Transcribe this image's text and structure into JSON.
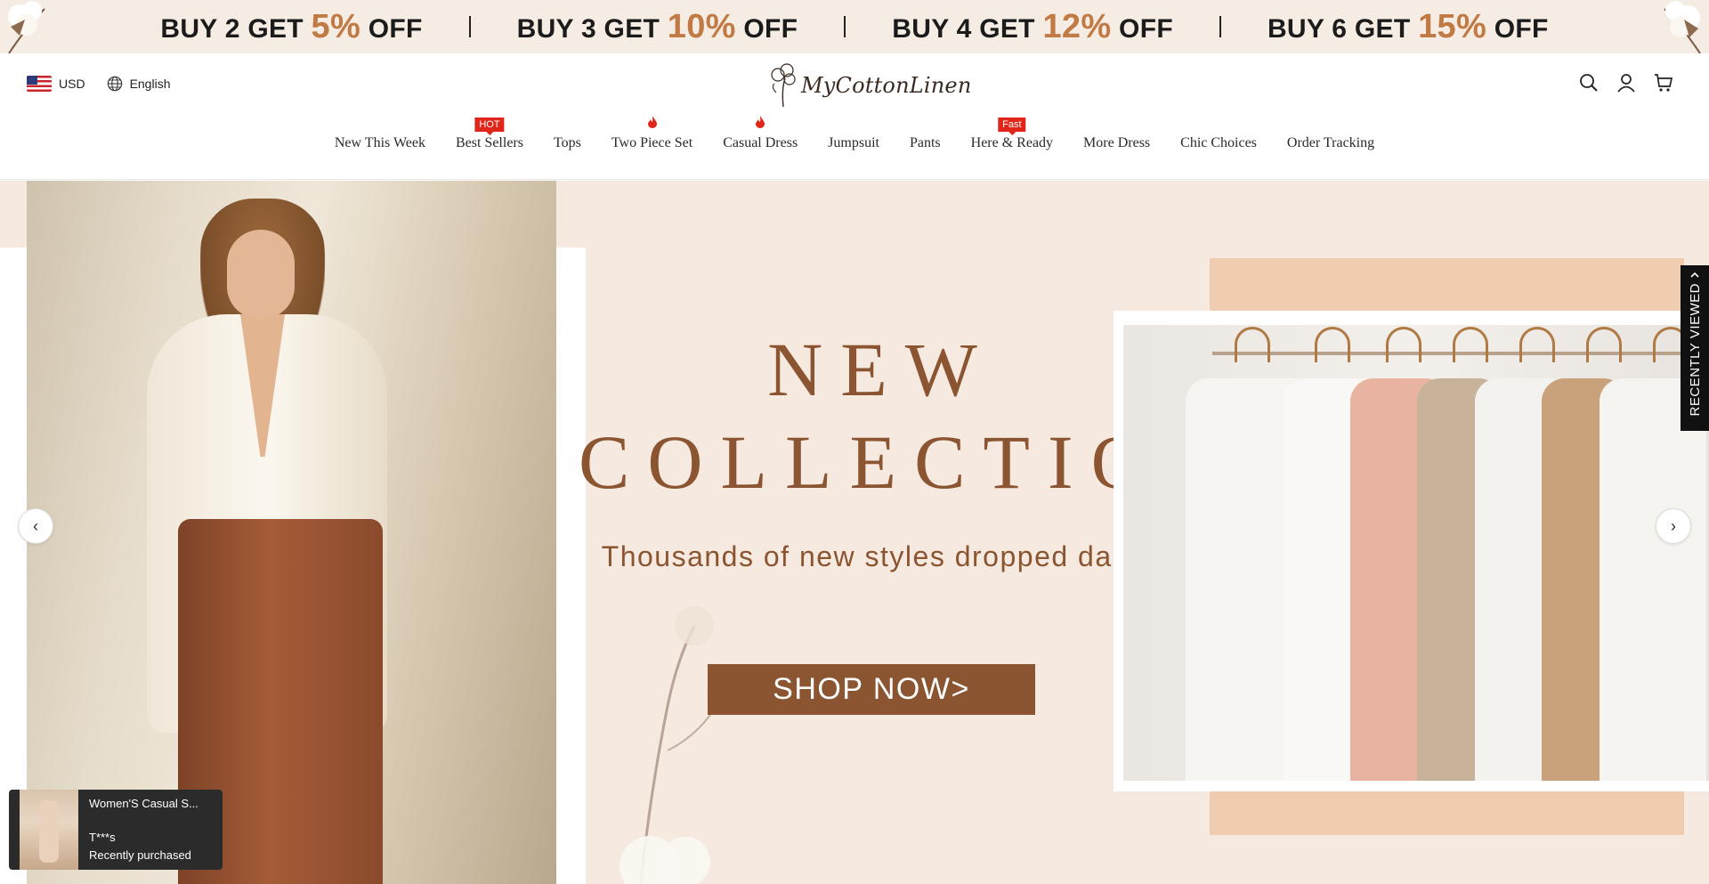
{
  "promo": {
    "items": [
      {
        "prefix": "BUY 2 GET ",
        "pct": "5%",
        "suffix": " OFF"
      },
      {
        "prefix": "BUY 3 GET ",
        "pct": "10%",
        "suffix": " OFF"
      },
      {
        "prefix": "BUY 4 GET ",
        "pct": "12%",
        "suffix": " OFF"
      },
      {
        "prefix": "BUY 6 GET ",
        "pct": "15%",
        "suffix": " OFF"
      }
    ],
    "accent_color": "#c27a45"
  },
  "header": {
    "currency": "USD",
    "language": "English",
    "logo_text": "MyCottonLinen",
    "icons": [
      "search-icon",
      "account-icon",
      "cart-icon"
    ]
  },
  "nav": {
    "items": [
      {
        "label": "New This Week"
      },
      {
        "label": "Best Sellers",
        "badge": "HOT"
      },
      {
        "label": "Tops"
      },
      {
        "label": "Two Piece Set",
        "fire": true
      },
      {
        "label": "Casual Dress",
        "fire": true
      },
      {
        "label": "Jumpsuit"
      },
      {
        "label": "Pants"
      },
      {
        "label": "Here & Ready",
        "badge": "Fast"
      },
      {
        "label": "More Dress"
      },
      {
        "label": "Chic Choices"
      },
      {
        "label": "Order Tracking"
      }
    ]
  },
  "hero": {
    "title_line1": "NEW",
    "title_line2": "COLLECTION",
    "subtitle": "Thousands of new styles dropped daily",
    "cta": "SHOP NOW>",
    "brand_color": "#8a5530",
    "prev_arrow": "‹",
    "next_arrow": "›"
  },
  "recently_viewed": {
    "label": "RECENTLY VIEWED"
  },
  "toast": {
    "title": "Women'S Casual S...",
    "buyer": "T***s",
    "status": "Recently purchased"
  }
}
